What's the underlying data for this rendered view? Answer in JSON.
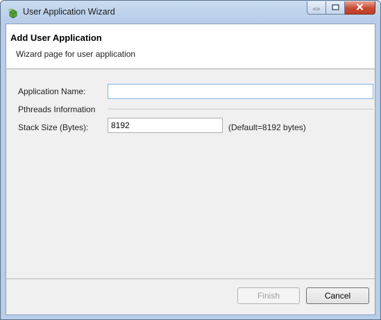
{
  "window": {
    "title": "User Application Wizard",
    "controls": {
      "minimize_icon": "minimize-icon",
      "maximize_icon": "maximize-icon",
      "close_icon": "close-icon"
    }
  },
  "header": {
    "title": "Add User Application",
    "description": "Wizard page for user application"
  },
  "form": {
    "app_name_label": "Application Name:",
    "app_name_value": "",
    "pthreads_section": "Pthreads Information",
    "stack_size_label": "Stack Size (Bytes):",
    "stack_size_value": "8192",
    "stack_size_hint": "(Default=8192 bytes)"
  },
  "buttons": {
    "finish": "Finish",
    "finish_enabled": false,
    "cancel": "Cancel"
  },
  "colors": {
    "titlebar": "#b7cde8",
    "client_bg": "#f0f0f0",
    "close_button": "#c74a31"
  }
}
